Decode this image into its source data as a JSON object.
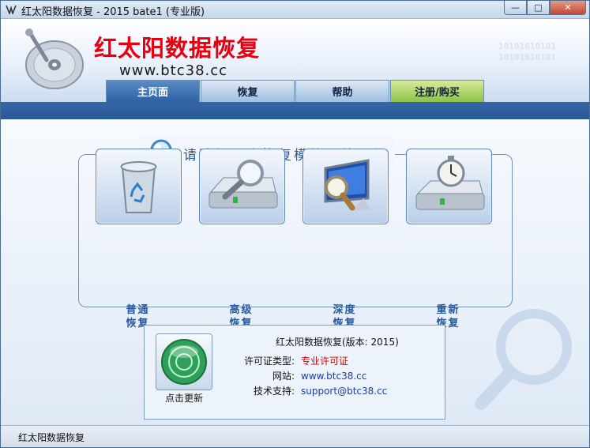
{
  "window": {
    "title": "红太阳数据恢复 - 2015 bate1 (专业版)"
  },
  "header": {
    "brand": "红太阳数据恢复",
    "site": "www.btc38.cc",
    "binary_lines": [
      "10101010101",
      "10101010101"
    ]
  },
  "tabs": [
    {
      "label": "主页面",
      "active": true
    },
    {
      "label": "恢复"
    },
    {
      "label": "帮助"
    },
    {
      "label": "注册/购买"
    }
  ],
  "main": {
    "prompt": "请选择一个恢复模块开始工作",
    "modules": [
      {
        "line1": "普通",
        "line2": "恢复",
        "icon": "recycle-bin-icon"
      },
      {
        "line1": "高级",
        "line2": "恢复",
        "icon": "disk-search-icon"
      },
      {
        "line1": "深度",
        "line2": "恢复",
        "icon": "monitor-search-icon"
      },
      {
        "line1": "重新",
        "line2": "恢复",
        "icon": "disk-stopwatch-icon"
      }
    ]
  },
  "info": {
    "title": "红太阳数据恢复(版本: 2015)",
    "update_label": "点击更新",
    "license_label": "许可证类型:",
    "license_value": "专业许可证",
    "website_label": "网站:",
    "website_value": "www.btc38.cc",
    "support_label": "技术支持:",
    "support_value": "support@btc38.cc"
  },
  "status": {
    "text": "红太阳数据恢复"
  },
  "colors": {
    "accent": "#2a5b9c",
    "brand_red": "#e60012",
    "license_red": "#e00000",
    "tab_blue": "#2e61a3",
    "register_green": "#8fc24a"
  }
}
